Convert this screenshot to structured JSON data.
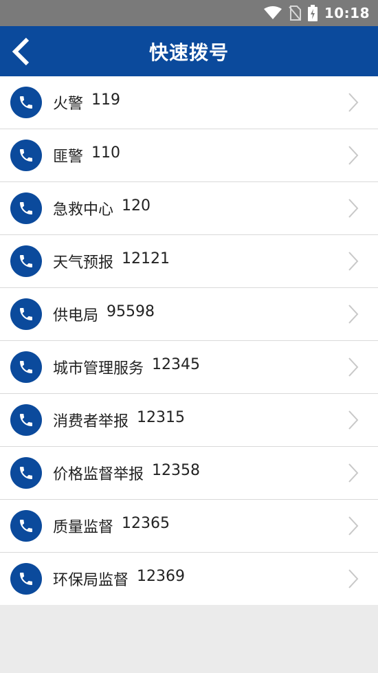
{
  "status_bar": {
    "time": "10:18",
    "icons": [
      "wifi-icon",
      "no-sim-icon",
      "battery-charging-icon"
    ]
  },
  "header": {
    "title": "快速拨号",
    "back_icon": "chevron-left-icon"
  },
  "colors": {
    "primary": "#0b4a9c",
    "status_bar": "#7a7a7a",
    "background": "#ebebeb",
    "divider": "#d9d9d9"
  },
  "items": [
    {
      "name": "火警",
      "number": "119"
    },
    {
      "name": "匪警",
      "number": "110"
    },
    {
      "name": "急救中心",
      "number": "120"
    },
    {
      "name": "天气预报",
      "number": "12121"
    },
    {
      "name": "供电局",
      "number": "95598"
    },
    {
      "name": "城市管理服务",
      "number": "12345"
    },
    {
      "name": "消费者举报",
      "number": "12315"
    },
    {
      "name": "价格监督举报",
      "number": "12358"
    },
    {
      "name": "质量监督",
      "number": "12365"
    },
    {
      "name": "环保局监督",
      "number": "12369"
    }
  ]
}
